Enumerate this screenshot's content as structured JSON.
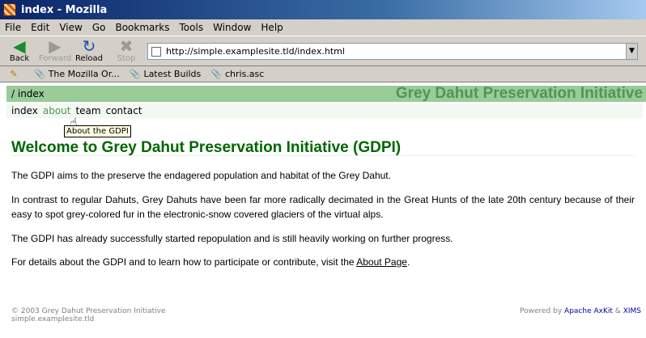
{
  "window": {
    "title": "index - Mozilla"
  },
  "menu": [
    "File",
    "Edit",
    "View",
    "Go",
    "Bookmarks",
    "Tools",
    "Window",
    "Help"
  ],
  "nav": {
    "back": "Back",
    "forward": "Forward",
    "reload": "Reload",
    "stop": "Stop",
    "url": "http://simple.examplesite.tld/index.html"
  },
  "bookmarks": [
    "The Mozilla Or...",
    "Latest Builds",
    "chris.asc"
  ],
  "page": {
    "breadcrumb": "/ index",
    "site_title": "Grey Dahut Preservation Initiative",
    "site_nav": [
      "index",
      "about",
      "team",
      "contact"
    ],
    "tooltip": "About the GDPI",
    "headline": "Welcome to Grey Dahut Preservation Initiative (GDPI)",
    "p1": "The GDPI aims to the preserve the endagered population and habitat of the Grey Dahut.",
    "p2": "In contrast to regular Dahuts, Grey Dahuts have been far more radically decimated in the Great Hunts of the late 20th century because of their easy to spot grey-colored fur in the electronic-snow covered glaciers of the virtual alps.",
    "p3": "The GDPI has already successfully started repopulation and is still heavily working on further progress.",
    "p4_prefix": "For details about the GDPI and to learn how to participate or contribute, visit the ",
    "p4_link": "About Page",
    "p4_suffix": ".",
    "footer_copyright": "© 2003 Grey Dahut Preservation Initiative",
    "footer_domain": "simple.examplesite.tld",
    "footer_powered": "Powered by",
    "footer_axkit": "Apache AxKit",
    "footer_and": "&",
    "footer_ximss": "XIMS"
  },
  "colors": {
    "accent_green": "#549454",
    "headline_green": "#006600",
    "crumbbar_bg": "#99cc99"
  }
}
